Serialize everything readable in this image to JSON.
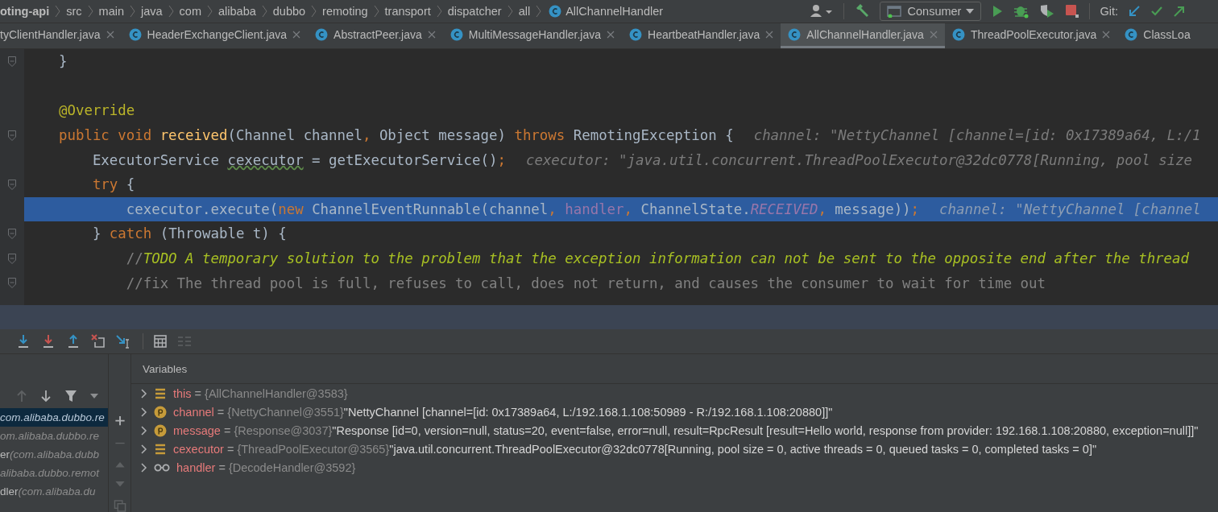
{
  "navigation_bar": {
    "breadcrumbs": [
      {
        "label": "oting-api",
        "kind": "module"
      },
      {
        "label": "src",
        "kind": "folder"
      },
      {
        "label": "main",
        "kind": "folder"
      },
      {
        "label": "java",
        "kind": "folder"
      },
      {
        "label": "com",
        "kind": "folder"
      },
      {
        "label": "alibaba",
        "kind": "folder"
      },
      {
        "label": "dubbo",
        "kind": "folder"
      },
      {
        "label": "remoting",
        "kind": "folder"
      },
      {
        "label": "transport",
        "kind": "folder"
      },
      {
        "label": "dispatcher",
        "kind": "folder"
      },
      {
        "label": "all",
        "kind": "folder"
      },
      {
        "label": "AllChannelHandler",
        "kind": "class"
      }
    ],
    "run_config": "Consumer",
    "vcs_label": "Git:"
  },
  "tabs": [
    {
      "label": "tyClientHandler.java",
      "selected": false,
      "icon": false,
      "closable": true
    },
    {
      "label": "HeaderExchangeClient.java",
      "selected": false,
      "icon": true,
      "closable": true
    },
    {
      "label": "AbstractPeer.java",
      "selected": false,
      "icon": true,
      "closable": true
    },
    {
      "label": "MultiMessageHandler.java",
      "selected": false,
      "icon": true,
      "closable": true
    },
    {
      "label": "HeartbeatHandler.java",
      "selected": false,
      "icon": true,
      "closable": true
    },
    {
      "label": "AllChannelHandler.java",
      "selected": true,
      "icon": true,
      "closable": true
    },
    {
      "label": "ThreadPoolExecutor.java",
      "selected": false,
      "icon": true,
      "closable": true
    },
    {
      "label": "ClassLoa",
      "selected": false,
      "icon": true,
      "closable": false
    }
  ],
  "editor": {
    "lines": [
      {
        "fold_marker": true,
        "current": false,
        "tokens": [
          {
            "t": "}",
            "kind": "plain"
          }
        ]
      },
      {
        "fold_marker": false,
        "current": false
      },
      {
        "fold_marker": false,
        "current": false,
        "tokens": [
          {
            "t": "@Override",
            "kind": "annotation"
          }
        ]
      },
      {
        "fold_marker": true,
        "current": false,
        "tokens": [
          {
            "t": "public void ",
            "kind": "keyword"
          },
          {
            "t": "received",
            "kind": "declaration"
          },
          {
            "t": "(Channel channel",
            "kind": "plain"
          },
          {
            "t": ", ",
            "kind": "keyword"
          },
          {
            "t": "Object message) ",
            "kind": "plain"
          },
          {
            "t": "throws ",
            "kind": "keyword"
          },
          {
            "t": "RemotingException {",
            "kind": "plain"
          }
        ],
        "hint": "channel: \"NettyChannel [channel=[id: 0x17389a64, L:/1"
      },
      {
        "fold_marker": false,
        "current": false,
        "tokens": [
          {
            "t": "    ExecutorService ",
            "kind": "plain"
          },
          {
            "t": "cexecutor",
            "kind": "warning"
          },
          {
            "t": " = getExecutorService()",
            "kind": "plain"
          },
          {
            "t": ";",
            "kind": "keyword"
          }
        ],
        "hint": "cexecutor: \"java.util.concurrent.ThreadPoolExecutor@32dc0778[Running, pool size"
      },
      {
        "fold_marker": true,
        "current": false,
        "tokens": [
          {
            "t": "    try",
            "kind": "keyword"
          },
          {
            "t": " {",
            "kind": "plain"
          }
        ]
      },
      {
        "fold_marker": false,
        "current": true,
        "tokens": [
          {
            "t": "        cexecutor.execute(",
            "kind": "plain"
          },
          {
            "t": "new",
            "kind": "keyword"
          },
          {
            "t": " ChannelEventRunnable(channel",
            "kind": "plain"
          },
          {
            "t": ", ",
            "kind": "keyword"
          },
          {
            "t": "handler",
            "kind": "field"
          },
          {
            "t": ", ",
            "kind": "keyword"
          },
          {
            "t": "ChannelState.",
            "kind": "plain"
          },
          {
            "t": "RECEIVED",
            "kind": "constant"
          },
          {
            "t": ", ",
            "kind": "keyword"
          },
          {
            "t": "message))",
            "kind": "plain"
          },
          {
            "t": ";",
            "kind": "keyword"
          }
        ],
        "hint": "channel: \"NettyChannel [channel"
      },
      {
        "fold_marker": true,
        "current": false,
        "tokens": [
          {
            "t": "    } ",
            "kind": "plain"
          },
          {
            "t": "catch",
            "kind": "keyword"
          },
          {
            "t": " (Throwable t) {",
            "kind": "plain"
          }
        ]
      },
      {
        "fold_marker": true,
        "current": false,
        "tokens": [
          {
            "t": "        //",
            "kind": "comment"
          },
          {
            "t": "TODO A temporary solution to the problem that the exception information can not be sent to the opposite end after the thread",
            "kind": "todo"
          }
        ]
      },
      {
        "fold_marker": true,
        "current": false,
        "tokens": [
          {
            "t": "        //fix The thread pool is full, refuses to call, does not return, and causes the consumer to wait for time out",
            "kind": "comment"
          }
        ]
      }
    ]
  },
  "debugger": {
    "frames": [
      {
        "location": "com.alibaba.dubbo.re",
        "selected": true
      },
      {
        "location": "om.alibaba.dubbo.re",
        "selected": false
      },
      {
        "method": "er",
        "location": "(com.alibaba.dubb",
        "selected": false
      },
      {
        "location": "alibaba.dubbo.remot",
        "selected": false
      },
      {
        "method": "dler",
        "location": "(com.alibaba.du",
        "selected": false
      }
    ],
    "variables_title": "Variables",
    "variables": [
      {
        "kind": "field",
        "name": "this",
        "operator": "=",
        "type": "{AllChannelHandler@3583}"
      },
      {
        "kind": "parameter",
        "name": "channel",
        "operator": "=",
        "type": "{NettyChannel@3551}",
        "value": "\"NettyChannel [channel=[id: 0x17389a64, L:/192.168.1.108:50989 - R:/192.168.1.108:20880]]\""
      },
      {
        "kind": "parameter",
        "name": "message",
        "operator": "=",
        "type": "{Response@3037}",
        "value": "\"Response [id=0, version=null, status=20, event=false, error=null, result=RpcResult [result=Hello world, response from provider: 192.168.1.108:20880, exception=null]]\""
      },
      {
        "kind": "field",
        "name": "cexecutor",
        "operator": "=",
        "type": "{ThreadPoolExecutor@3565}",
        "value": "\"java.util.concurrent.ThreadPoolExecutor@32dc0778[Running, pool size = 0, active threads = 0, queued tasks = 0, completed tasks = 0]\""
      },
      {
        "kind": "watch",
        "name": "handler",
        "operator": "=",
        "type": "{DecodeHandler@3592}"
      }
    ]
  }
}
